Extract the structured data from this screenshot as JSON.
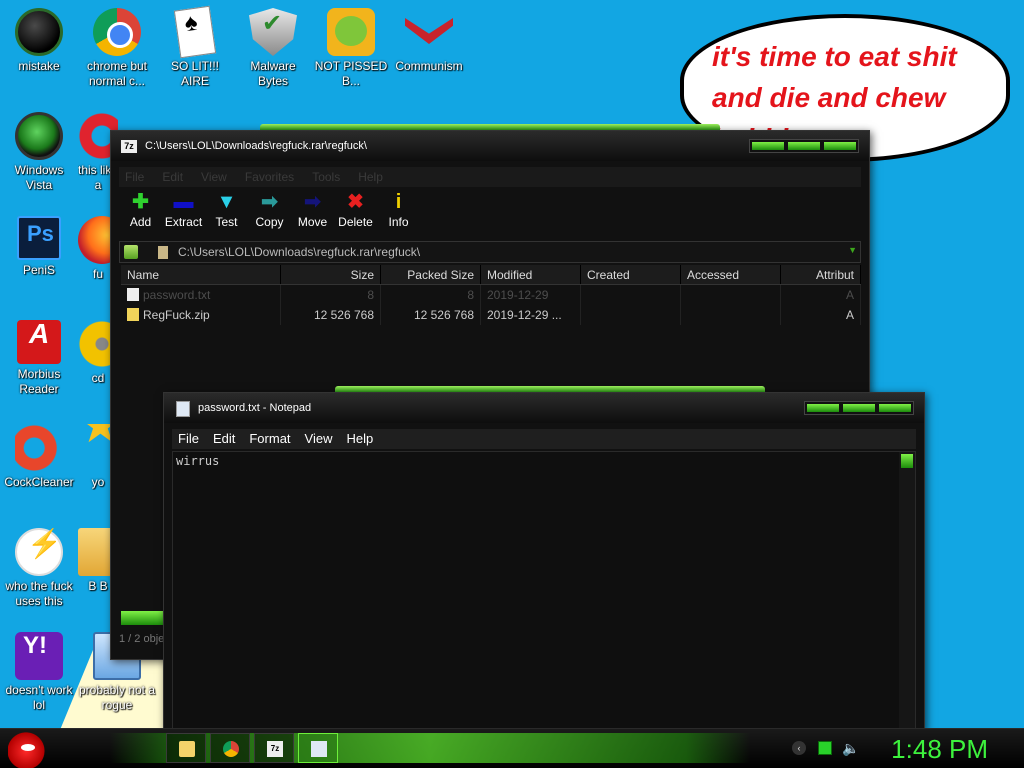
{
  "desktop": {
    "icons": [
      {
        "label": "mistake"
      },
      {
        "label": "chrome but normal c..."
      },
      {
        "label": "SO LIT!!! AIRE"
      },
      {
        "label": "Malware Bytes"
      },
      {
        "label": "NOT PISSED B..."
      },
      {
        "label": "Communism"
      },
      {
        "label": "Windows Vista"
      },
      {
        "label": "this like a"
      },
      {
        "label": "PeniS"
      },
      {
        "label": "fu"
      },
      {
        "label": "Morbius Reader"
      },
      {
        "label": "cd"
      },
      {
        "label": "CockCleaner"
      },
      {
        "label": "yo"
      },
      {
        "label": "who the fuck uses this"
      },
      {
        "label": "B B"
      },
      {
        "label": "doesn't work lol"
      },
      {
        "label": "probably not a rogue"
      }
    ],
    "bubble_text": "it's time to eat shit and die and chew bubble gum"
  },
  "sevenzip": {
    "title": "C:\\Users\\LOL\\Downloads\\regfuck.rar\\regfuck\\",
    "logo": "7z",
    "menu": [
      "File",
      "Edit",
      "View",
      "Favorites",
      "Tools",
      "Help"
    ],
    "toolbar": [
      {
        "label": "Add",
        "icon": "plus-icon",
        "glyph": "✚"
      },
      {
        "label": "Extract",
        "icon": "minus-icon",
        "glyph": "▬"
      },
      {
        "label": "Test",
        "icon": "check-down-icon",
        "glyph": "▼"
      },
      {
        "label": "Copy",
        "icon": "copy-arrow-icon",
        "glyph": "➡"
      },
      {
        "label": "Move",
        "icon": "move-arrow-icon",
        "glyph": "➡"
      },
      {
        "label": "Delete",
        "icon": "x-icon",
        "glyph": "✖"
      },
      {
        "label": "Info",
        "icon": "info-icon",
        "glyph": "i"
      }
    ],
    "address": "C:\\Users\\LOL\\Downloads\\regfuck.rar\\regfuck\\",
    "columns": [
      "Name",
      "Size",
      "Packed Size",
      "Modified",
      "Created",
      "Accessed",
      "Attribut"
    ],
    "rows": [
      {
        "name": "password.txt",
        "size": "8",
        "packed": "8",
        "modified": "2019-12-29",
        "created": "",
        "accessed": "",
        "attr": "A"
      },
      {
        "name": "RegFuck.zip",
        "size": "12 526 768",
        "packed": "12 526 768",
        "modified": "2019-12-29 ...",
        "created": "",
        "accessed": "",
        "attr": "A"
      }
    ],
    "status": "1 / 2 obje"
  },
  "notepad": {
    "title": "password.txt - Notepad",
    "menu": [
      "File",
      "Edit",
      "Format",
      "View",
      "Help"
    ],
    "content": "wirrus"
  },
  "taskbar": {
    "clock": "1:48 PM",
    "tray_chevron": "‹",
    "volume_glyph": "🔈",
    "seven_zip_label": "7z"
  },
  "colors": {
    "desktop": "#12a6e3",
    "accent_green": "#3df23d",
    "bubble_text": "#e4141b"
  }
}
